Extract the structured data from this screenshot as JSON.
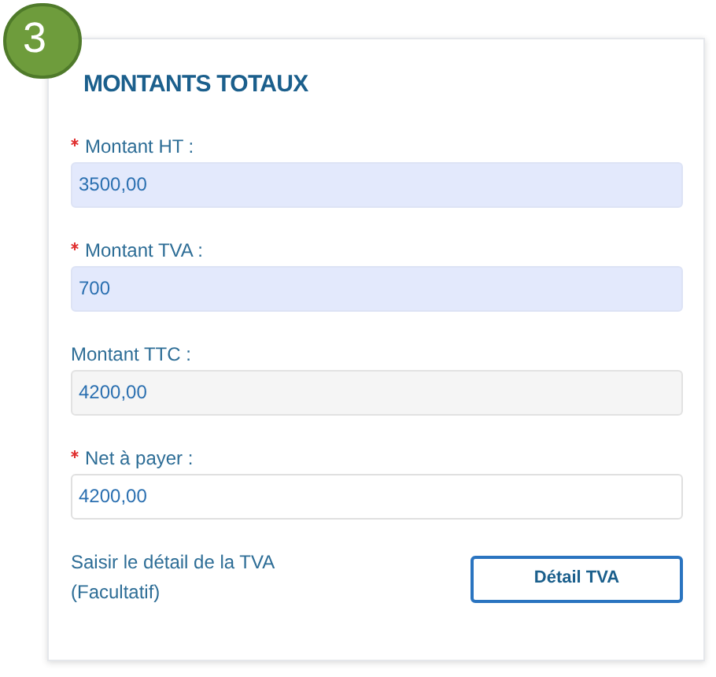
{
  "step_badge": "3",
  "title": "MONTANTS TOTAUX",
  "fields": [
    {
      "label": "Montant HT :",
      "required": true,
      "kind": "highlighted",
      "value": "3500,00"
    },
    {
      "label": "Montant TVA :",
      "required": true,
      "kind": "highlighted",
      "value": "700"
    },
    {
      "label": "Montant TTC :",
      "required": false,
      "kind": "readonly",
      "value": "4200,00"
    },
    {
      "label": "Net à payer :",
      "required": true,
      "kind": "plain",
      "value": "4200,00"
    }
  ],
  "vat_detail": {
    "hint_lines": [
      "Saisir le détail de la TVA",
      "(Facultatif)"
    ],
    "button": "Détail TVA"
  }
}
